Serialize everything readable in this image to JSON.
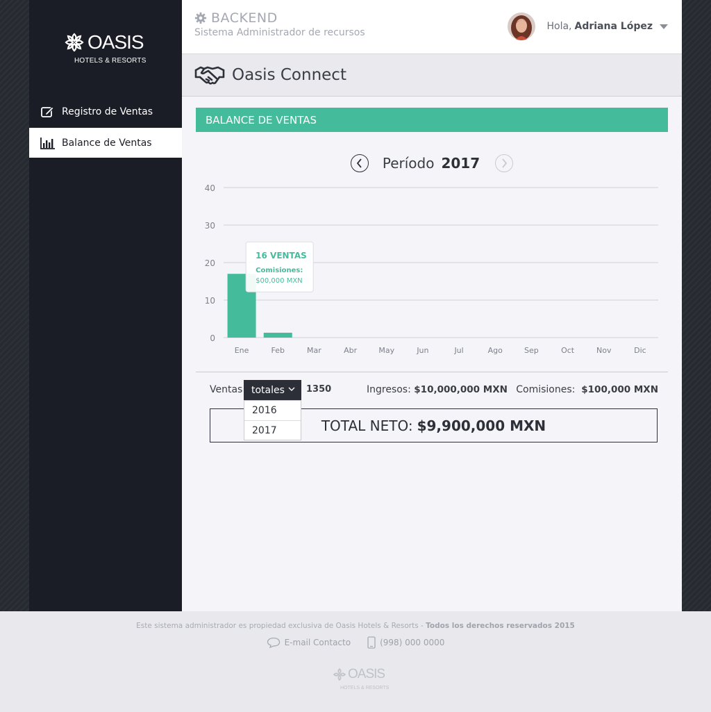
{
  "sidebar": {
    "logo": {
      "word": "OASIS",
      "sub": "HOTELS & RESORTS"
    },
    "items": [
      {
        "label": "Registro de Ventas",
        "icon": "edit-icon",
        "active": false
      },
      {
        "label": "Balance de Ventas",
        "icon": "bar-chart-icon",
        "active": true
      }
    ]
  },
  "header": {
    "brand": "BACKEND",
    "subtitle": "Sistema Administrador de recursos",
    "greeting": "Hola,",
    "user_name": "Adriana López"
  },
  "section": {
    "title": "Oasis Connect",
    "icon": "handshake-icon"
  },
  "panel": {
    "title": "BALANCE DE VENTAS"
  },
  "period": {
    "label": "Período",
    "year": "2017"
  },
  "chart_data": {
    "type": "bar",
    "categories": [
      "Ene",
      "Feb",
      "Mar",
      "Abr",
      "May",
      "Jun",
      "Jul",
      "Ago",
      "Sep",
      "Oct",
      "Nov",
      "Dic"
    ],
    "values": [
      17,
      1.3,
      0,
      0,
      0,
      0,
      0,
      0,
      0,
      0,
      0,
      0
    ],
    "yticks": [
      0,
      10,
      20,
      30,
      40
    ],
    "ylim": [
      0,
      40
    ],
    "grid": true,
    "bar_color": "#44bc9c",
    "tooltip": {
      "title": "16 VENTAS",
      "line1": "Comisiones:",
      "line2": "$00,000 MXN"
    }
  },
  "stats": {
    "ventas_label": "Ventas",
    "select_value": "totales",
    "count": "1350",
    "ingresos_label": "Ingresos:",
    "ingresos_value": "$10,000,000 MXN",
    "comisiones_label": "Comisiones:",
    "comisiones_value": "$100,000 MXN",
    "dropdown_options": [
      "2016",
      "2017"
    ]
  },
  "total": {
    "label": "TOTAL NETO:",
    "value": "$9,900,000 MXN"
  },
  "footer": {
    "legal": "Este sistema administrador es propiedad exclusiva de Oasis Hotels & Resorts  -",
    "rights": "Todos los derechos reservados 2015",
    "email_label": "E-mail Contacto",
    "phone": "(998) 000 0000",
    "logo_word": "OASIS",
    "logo_sub": "HOTELS & RESORTS"
  },
  "colors": {
    "accent": "#44bc9c",
    "sidebar": "#1b1d26",
    "main_bg": "#f5f5f9"
  }
}
